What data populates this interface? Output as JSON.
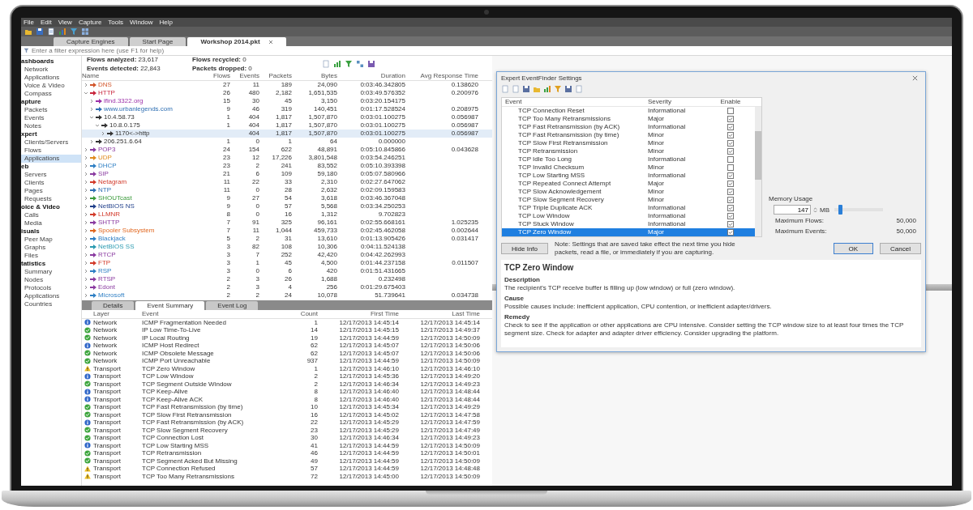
{
  "menu_bar": [
    "File",
    "Edit",
    "View",
    "Capture",
    "Tools",
    "Window",
    "Help"
  ],
  "document_tabs": [
    {
      "label": "Capture Engines",
      "selected": false,
      "closable": false
    },
    {
      "label": "Start Page",
      "selected": false,
      "closable": false
    },
    {
      "label": "Workshop 2014.pkt",
      "selected": true,
      "closable": true
    }
  ],
  "filter": {
    "placeholder": "Enter a filter expression here (use F1 for help)"
  },
  "sidebar": {
    "groups": [
      {
        "label": "ashboards",
        "items": [
          {
            "label": "Network",
            "selected": false
          },
          {
            "label": "Applications",
            "selected": false
          },
          {
            "label": "Voice & Video",
            "selected": false
          },
          {
            "label": "Compass",
            "selected": false
          }
        ]
      },
      {
        "label": "apture",
        "items": [
          {
            "label": "Packets",
            "selected": false
          },
          {
            "label": "Events",
            "selected": false
          },
          {
            "label": "Notes",
            "selected": false
          }
        ]
      },
      {
        "label": "xpert",
        "items": [
          {
            "label": "Clients/Servers",
            "selected": false
          },
          {
            "label": "Flows",
            "selected": false
          },
          {
            "label": "Applications",
            "selected": true
          }
        ]
      },
      {
        "label": "eb",
        "items": [
          {
            "label": "Servers",
            "selected": false
          },
          {
            "label": "Clients",
            "selected": false
          },
          {
            "label": "Pages",
            "selected": false
          },
          {
            "label": "Requests",
            "selected": false
          }
        ]
      },
      {
        "label": "oice & Video",
        "items": [
          {
            "label": "Calls",
            "selected": false
          },
          {
            "label": "Media",
            "selected": false
          }
        ]
      },
      {
        "label": "isuals",
        "items": [
          {
            "label": "Peer Map",
            "selected": false
          },
          {
            "label": "Graphs",
            "selected": false
          },
          {
            "label": "Files",
            "selected": false
          }
        ]
      },
      {
        "label": "tatistics",
        "items": [
          {
            "label": "Summary",
            "selected": false
          },
          {
            "label": "Nodes",
            "selected": false
          },
          {
            "label": "Protocols",
            "selected": false
          },
          {
            "label": "Applications",
            "selected": false
          },
          {
            "label": "Countries",
            "selected": false
          }
        ]
      }
    ]
  },
  "summary": [
    "**Flows analyzed:** 23,617",
    "**Flows recycled:** 0",
    "**Events detected:** 22,843",
    "**Packets dropped:** 0"
  ],
  "flows": {
    "columns": [
      "Name",
      "Flows",
      "Events",
      "Packets",
      "Bytes",
      "Duration",
      "Avg Response Time"
    ],
    "rows": [
      {
        "name": "DNS",
        "color": "#d2552a",
        "expanded": false,
        "selected": false,
        "flows": "27",
        "events": "11",
        "packets": "189",
        "bytes": "24,090",
        "duration": "0:03:46.342805",
        "avg": "0.138620"
      },
      {
        "name": "HTTP",
        "color": "#c8253c",
        "expanded": true,
        "selected": false,
        "flows": "26",
        "events": "480",
        "packets": "2,182",
        "bytes": "1,651,535",
        "duration": "0:03:49.576352",
        "avg": "0.200976",
        "children": [
          {
            "name": "ifind.3322.org",
            "color": "#9b2fa8",
            "expanded": false,
            "selected": false,
            "flows": "15",
            "events": "30",
            "packets": "45",
            "bytes": "3,150",
            "duration": "0:03:20.154175"
          },
          {
            "name": "www.urbanlegends.com",
            "color": "#2e6fb3",
            "expanded": false,
            "selected": false,
            "flows": "9",
            "events": "46",
            "packets": "319",
            "bytes": "140,451",
            "duration": "0:01:17.528524",
            "avg": "0.208975"
          },
          {
            "name": "10.4.58.73",
            "color": "#333333",
            "expanded": true,
            "selected": false,
            "flows": "1",
            "events": "404",
            "packets": "1,817",
            "bytes": "1,507,870",
            "duration": "0:03:01.100275",
            "avg": "0.056987",
            "children": [
              {
                "name": "10.8.0.175",
                "color": "#333333",
                "expanded": true,
                "selected": false,
                "flows": "1",
                "events": "404",
                "packets": "1,817",
                "bytes": "1,507,870",
                "duration": "0:03:01.100275",
                "avg": "0.056987",
                "children": [
                  {
                    "name": "1170<->http",
                    "color": "#333333",
                    "expanded": false,
                    "selected": true,
                    "events": "404",
                    "packets": "1,817",
                    "bytes": "1,507,870",
                    "duration": "0:03:01.100275",
                    "avg": "0.056987"
                  }
                ]
              }
            ]
          },
          {
            "name": "206.251.6.64",
            "color": "#333333",
            "expanded": false,
            "selected": false,
            "flows": "1",
            "events": "0",
            "packets": "1",
            "bytes": "64",
            "duration": "0.000000"
          }
        ]
      },
      {
        "name": "POP3",
        "color": "#8a3aa0",
        "expanded": false,
        "selected": false,
        "flows": "24",
        "events": "154",
        "packets": "622",
        "bytes": "48,891",
        "duration": "0:05:10.845866",
        "avg": "0.043628"
      },
      {
        "name": "UDP",
        "color": "#e08a1e",
        "expanded": false,
        "selected": false,
        "flows": "23",
        "events": "12",
        "packets": "17,226",
        "bytes": "3,801,548",
        "duration": "0:03:54.246251"
      },
      {
        "name": "DHCP",
        "color": "#2e7fc4",
        "expanded": false,
        "selected": false,
        "flows": "23",
        "events": "2",
        "packets": "241",
        "bytes": "83,552",
        "duration": "0:05:10.393398"
      },
      {
        "name": "SIP",
        "color": "#8a3aa0",
        "expanded": false,
        "selected": false,
        "flows": "21",
        "events": "6",
        "packets": "109",
        "bytes": "59,180",
        "duration": "0:05:07.580966"
      },
      {
        "name": "Netagram",
        "color": "#d23a2a",
        "expanded": false,
        "selected": false,
        "flows": "11",
        "events": "22",
        "packets": "33",
        "bytes": "2,310",
        "duration": "0:02:27.647062"
      },
      {
        "name": "NTP",
        "color": "#2e6fb3",
        "expanded": false,
        "selected": false,
        "flows": "11",
        "events": "0",
        "packets": "28",
        "bytes": "2,632",
        "duration": "0:02:09.159583"
      },
      {
        "name": "SHOUTcast",
        "color": "#3a9a3a",
        "expanded": false,
        "selected": false,
        "flows": "9",
        "events": "27",
        "packets": "54",
        "bytes": "3,618",
        "duration": "0:03:46.367048"
      },
      {
        "name": "NetBIOS NS",
        "color": "#1f3f8a",
        "expanded": false,
        "selected": false,
        "flows": "9",
        "events": "0",
        "packets": "57",
        "bytes": "5,568",
        "duration": "0:03:34.250253"
      },
      {
        "name": "LLMNR",
        "color": "#d23a2a",
        "expanded": false,
        "selected": false,
        "flows": "8",
        "events": "0",
        "packets": "16",
        "bytes": "1,312",
        "duration": "9.702823"
      },
      {
        "name": "SHTTP",
        "color": "#8a3aa0",
        "expanded": false,
        "selected": false,
        "flows": "7",
        "events": "91",
        "packets": "325",
        "bytes": "96,161",
        "duration": "0:02:55.668161",
        "avg": "1.025235"
      },
      {
        "name": "Spooler Subsystem",
        "color": "#e0661e",
        "expanded": false,
        "selected": false,
        "flows": "7",
        "events": "11",
        "packets": "1,044",
        "bytes": "459,733",
        "duration": "0:02:45.462058",
        "avg": "0.002644"
      },
      {
        "name": "Blackjack",
        "color": "#2e7fc4",
        "expanded": false,
        "selected": false,
        "flows": "5",
        "events": "2",
        "packets": "31",
        "bytes": "13,610",
        "duration": "0:01:13.905426",
        "avg": "0.031417"
      },
      {
        "name": "NetBIOS SS",
        "color": "#2a9ab0",
        "expanded": false,
        "selected": false,
        "flows": "3",
        "events": "82",
        "packets": "108",
        "bytes": "10,306",
        "duration": "0:04:11.524138"
      },
      {
        "name": "RTCP",
        "color": "#8a3aa0",
        "expanded": false,
        "selected": false,
        "flows": "3",
        "events": "7",
        "packets": "252",
        "bytes": "42,420",
        "duration": "0:04:42.262993"
      },
      {
        "name": "FTP",
        "color": "#d23a2a",
        "expanded": false,
        "selected": false,
        "flows": "3",
        "events": "1",
        "packets": "45",
        "bytes": "4,500",
        "duration": "0:01:44.237158",
        "avg": "0.011507"
      },
      {
        "name": "RSP",
        "color": "#2e7fc4",
        "expanded": false,
        "selected": false,
        "flows": "3",
        "events": "0",
        "packets": "6",
        "bytes": "420",
        "duration": "0:01:51.431665"
      },
      {
        "name": "RTSP",
        "color": "#8a3aa0",
        "expanded": false,
        "selected": false,
        "flows": "2",
        "events": "3",
        "packets": "26",
        "bytes": "1,688",
        "duration": "0.232498"
      },
      {
        "name": "Edont",
        "color": "#8a3aa0",
        "expanded": false,
        "selected": false,
        "flows": "2",
        "events": "3",
        "packets": "4",
        "bytes": "256",
        "duration": "0:01:29.675403"
      },
      {
        "name": "Microsoft",
        "color": "#2e7fc4",
        "expanded": false,
        "selected": false,
        "flows": "2",
        "events": "2",
        "packets": "24",
        "bytes": "10,078",
        "duration": "51.739641",
        "avg": "0.034738"
      }
    ]
  },
  "bottom_tabs": [
    {
      "label": "Details",
      "selected": false
    },
    {
      "label": "Event Summary",
      "selected": true
    },
    {
      "label": "Event Log",
      "selected": false
    }
  ],
  "events_table": {
    "columns": [
      "Layer",
      "Event",
      "Count",
      "First Time",
      "Last Time"
    ],
    "rows": [
      {
        "kind": "info",
        "layer": "Network",
        "event": "ICMP Fragmentation Needed",
        "count": "1",
        "first": "12/17/2013 14:45:14",
        "last": "12/17/2013 14:45:14"
      },
      {
        "kind": "ok",
        "layer": "Network",
        "event": "IP Low Time-To-Live",
        "count": "14",
        "first": "12/17/2013 14:45:15",
        "last": "12/17/2013 14:49:37"
      },
      {
        "kind": "ok",
        "layer": "Network",
        "event": "IP Local Routing",
        "count": "19",
        "first": "12/17/2013 14:44:59",
        "last": "12/17/2013 14:50:09"
      },
      {
        "kind": "info",
        "layer": "Network",
        "event": "ICMP Host Redirect",
        "count": "62",
        "first": "12/17/2013 14:45:07",
        "last": "12/17/2013 14:50:06"
      },
      {
        "kind": "ok",
        "layer": "Network",
        "event": "ICMP Obsolete Message",
        "count": "62",
        "first": "12/17/2013 14:45:07",
        "last": "12/17/2013 14:50:06"
      },
      {
        "kind": "ok",
        "layer": "Network",
        "event": "ICMP Port Unreachable",
        "count": "937",
        "first": "12/17/2013 14:44:59",
        "last": "12/17/2013 14:50:09"
      },
      {
        "kind": "warn",
        "layer": "Transport",
        "event": "TCP Zero Window",
        "count": "1",
        "first": "12/17/2013 14:46:10",
        "last": "12/17/2013 14:46:10"
      },
      {
        "kind": "info",
        "layer": "Transport",
        "event": "TCP Low Window",
        "count": "2",
        "first": "12/17/2013 14:45:36",
        "last": "12/17/2013 14:49:20"
      },
      {
        "kind": "ok",
        "layer": "Transport",
        "event": "TCP Segment Outside Window",
        "count": "2",
        "first": "12/17/2013 14:46:34",
        "last": "12/17/2013 14:49:23"
      },
      {
        "kind": "info",
        "layer": "Transport",
        "event": "TCP Keep-Alive",
        "count": "8",
        "first": "12/17/2013 14:46:40",
        "last": "12/17/2013 14:48:44"
      },
      {
        "kind": "info",
        "layer": "Transport",
        "event": "TCP Keep-Alive ACK",
        "count": "8",
        "first": "12/17/2013 14:46:40",
        "last": "12/17/2013 14:48:44"
      },
      {
        "kind": "ok",
        "layer": "Transport",
        "event": "TCP Fast Retransmission (by time)",
        "count": "10",
        "first": "12/17/2013 14:45:34",
        "last": "12/17/2013 14:49:29"
      },
      {
        "kind": "ok",
        "layer": "Transport",
        "event": "TCP Slow First Retransmission",
        "count": "16",
        "first": "12/17/2013 14:45:02",
        "last": "12/17/2013 14:47:58"
      },
      {
        "kind": "info",
        "layer": "Transport",
        "event": "TCP Fast Retransmission (by ACK)",
        "count": "22",
        "first": "12/17/2013 14:45:29",
        "last": "12/17/2013 14:47:59"
      },
      {
        "kind": "ok",
        "layer": "Transport",
        "event": "TCP Slow Segment Recovery",
        "count": "23",
        "first": "12/17/2013 14:45:29",
        "last": "12/17/2013 14:47:49"
      },
      {
        "kind": "ok",
        "layer": "Transport",
        "event": "TCP Connection Lost",
        "count": "30",
        "first": "12/17/2013 14:46:34",
        "last": "12/17/2013 14:49:23"
      },
      {
        "kind": "info",
        "layer": "Transport",
        "event": "TCP Low Starting MSS",
        "count": "41",
        "first": "12/17/2013 14:44:59",
        "last": "12/17/2013 14:50:09"
      },
      {
        "kind": "ok",
        "layer": "Transport",
        "event": "TCP Retransmission",
        "count": "46",
        "first": "12/17/2013 14:44:59",
        "last": "12/17/2013 14:50:01"
      },
      {
        "kind": "ok",
        "layer": "Transport",
        "event": "TCP Segment Acked But Missing",
        "count": "49",
        "first": "12/17/2013 14:44:59",
        "last": "12/17/2013 14:50:09"
      },
      {
        "kind": "warn",
        "layer": "Transport",
        "event": "TCP Connection Refused",
        "count": "57",
        "first": "12/17/2013 14:44:59",
        "last": "12/17/2013 14:48:48"
      },
      {
        "kind": "warn",
        "layer": "Transport",
        "event": "TCP Too Many Retransmissions",
        "count": "72",
        "first": "12/17/2013 14:45:00",
        "last": "12/17/2013 14:50:09"
      }
    ]
  },
  "dialog": {
    "title": "Expert EventFinder Settings",
    "columns": [
      "Event",
      "Severity",
      "Enable"
    ],
    "rows": [
      {
        "event": "TCP Connection Reset",
        "severity": "Informational",
        "enabled": false,
        "selected": false
      },
      {
        "event": "TCP Too Many Retransmissions",
        "severity": "Major",
        "enabled": true,
        "selected": false
      },
      {
        "event": "TCP Fast Retransmission (by ACK)",
        "severity": "Informational",
        "enabled": true,
        "selected": false
      },
      {
        "event": "TCP Fast Retransmission (by time)",
        "severity": "Minor",
        "enabled": true,
        "selected": false
      },
      {
        "event": "TCP Slow First Retransmission",
        "severity": "Minor",
        "enabled": true,
        "selected": false
      },
      {
        "event": "TCP Retransmission",
        "severity": "Minor",
        "enabled": true,
        "selected": false
      },
      {
        "event": "TCP Idle Too Long",
        "severity": "Informational",
        "enabled": false,
        "selected": false
      },
      {
        "event": "TCP Invalid Checksum",
        "severity": "Minor",
        "enabled": false,
        "selected": false
      },
      {
        "event": "TCP Low Starting MSS",
        "severity": "Informational",
        "enabled": true,
        "selected": false
      },
      {
        "event": "TCP Repeated Connect Attempt",
        "severity": "Major",
        "enabled": true,
        "selected": false
      },
      {
        "event": "TCP Slow Acknowledgement",
        "severity": "Minor",
        "enabled": true,
        "selected": false
      },
      {
        "event": "TCP Slow Segment Recovery",
        "severity": "Minor",
        "enabled": true,
        "selected": false
      },
      {
        "event": "TCP Triple Duplicate ACK",
        "severity": "Informational",
        "enabled": true,
        "selected": false
      },
      {
        "event": "TCP Low Window",
        "severity": "Informational",
        "enabled": true,
        "selected": false
      },
      {
        "event": "TCP Stuck Window",
        "severity": "Informational",
        "enabled": true,
        "selected": false
      },
      {
        "event": "TCP Zero Window",
        "severity": "Major",
        "enabled": true,
        "selected": true
      }
    ],
    "memory": {
      "label": "Memory Usage",
      "value": "147",
      "unit": "MB",
      "level": 0.08
    },
    "limits": [
      {
        "label": "Maximum Flows:",
        "value": "50,000"
      },
      {
        "label": "Maximum Events:",
        "value": "50,000"
      }
    ],
    "hide_info_button": "Hide Info",
    "note": "Note: Settings that are saved take effect the next time you hide packets, read a file, or immediately if you are capturing.",
    "ok_button": "OK",
    "cancel_button": "Cancel",
    "info": {
      "title": "TCP Zero Window",
      "sections": [
        {
          "heading": "Description",
          "text": "The recipient's TCP receive buffer is filling up (low window) or full (zero window)."
        },
        {
          "heading": "Cause",
          "text": "Possible causes include: inefficient application, CPU contention, or inefficient adapter/drivers."
        },
        {
          "heading": "Remedy",
          "text": "Check to see if the application or other applications are CPU intensive. Consider setting the TCP window size to at least four times the TCP segment size. Check for adapter and adapter driver efficiency. Consider upgrading the platform."
        }
      ]
    }
  }
}
